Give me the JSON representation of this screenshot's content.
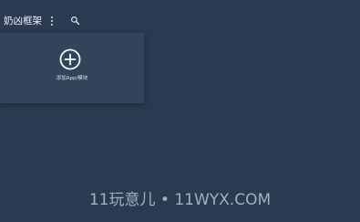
{
  "header": {
    "title": "奶凶框架",
    "menu_icon": "more-vert-icon",
    "search_icon": "search-icon"
  },
  "card": {
    "icon": "add-circle-icon",
    "label": "添加App/模块"
  },
  "watermark": {
    "text": "11玩意儿 • 11WYX.COM"
  },
  "colors": {
    "background": "#2a3a51",
    "card_background": "#314459",
    "text": "#e9edf2"
  }
}
